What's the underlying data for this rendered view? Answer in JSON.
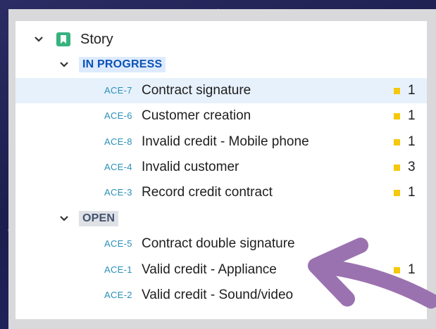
{
  "colors": {
    "story_icon": "#36b37e",
    "in_progress_text": "#0b52b5",
    "in_progress_bg": "#deebff",
    "open_text": "#42526e",
    "open_bg": "#dfe1e6",
    "key_text": "#2a8fb8",
    "priority_square": "#f6c80b",
    "selected_row_bg": "#e7f1fb",
    "annotation_arrow": "#9b72b0"
  },
  "icons": {
    "expand": "chevron-down",
    "story": "bookmark"
  },
  "story": {
    "label": "Story"
  },
  "groups": [
    {
      "status": "IN PROGRESS",
      "items": [
        {
          "key": "ACE-7",
          "title": "Contract signature",
          "count": "1",
          "selected": true
        },
        {
          "key": "ACE-6",
          "title": "Customer creation",
          "count": "1"
        },
        {
          "key": "ACE-8",
          "title": "Invalid credit - Mobile phone",
          "count": "1"
        },
        {
          "key": "ACE-4",
          "title": "Invalid customer",
          "count": "3"
        },
        {
          "key": "ACE-3",
          "title": "Record credit contract",
          "count": "1"
        }
      ]
    },
    {
      "status": "OPEN",
      "items": [
        {
          "key": "ACE-5",
          "title": "Contract double signature",
          "count": ""
        },
        {
          "key": "ACE-1",
          "title": "Valid credit - Appliance",
          "count": "1"
        },
        {
          "key": "ACE-2",
          "title": "Valid credit - Sound/video",
          "count": ""
        }
      ]
    }
  ]
}
